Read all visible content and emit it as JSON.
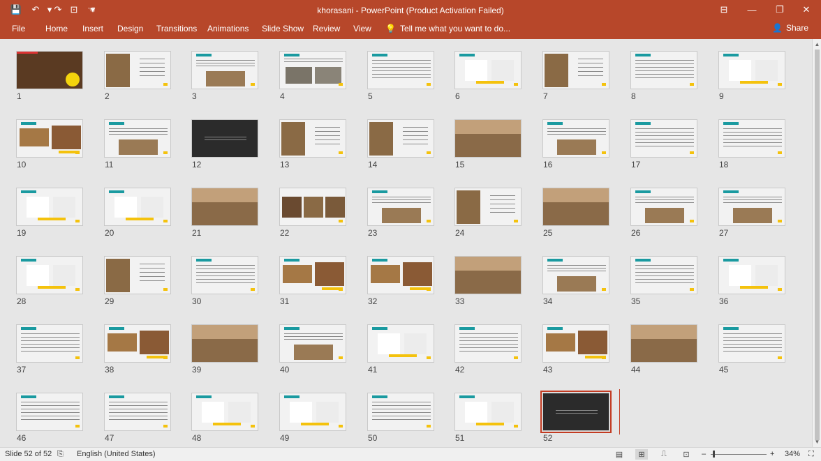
{
  "app": {
    "title": "khorasani - PowerPoint (Product Activation Failed)",
    "quick_access": [
      {
        "name": "save-icon",
        "glyph": "💾"
      },
      {
        "name": "undo-icon",
        "glyph": "↶"
      },
      {
        "name": "undo-dropdown-icon",
        "glyph": "▾"
      },
      {
        "name": "redo-icon",
        "glyph": "↷"
      },
      {
        "name": "start-from-beginning-icon",
        "glyph": "⊡"
      },
      {
        "name": "touch-mode-icon",
        "glyph": "☜"
      },
      {
        "name": "customize-qat-icon",
        "glyph": "▾"
      }
    ],
    "window_buttons": [
      {
        "name": "ribbon-display-options-icon",
        "glyph": "⊟"
      },
      {
        "name": "minimize-icon",
        "glyph": "—"
      },
      {
        "name": "restore-icon",
        "glyph": "❐"
      },
      {
        "name": "close-icon",
        "glyph": "✕"
      }
    ]
  },
  "ribbon": {
    "tabs": [
      "File",
      "Home",
      "Insert",
      "Design",
      "Transitions",
      "Animations",
      "Slide Show",
      "Review",
      "View"
    ],
    "tell_me": "Tell me what you want to do...",
    "share": "Share"
  },
  "slides": [
    {
      "n": "1",
      "style": "photo-title",
      "selected": false
    },
    {
      "n": "2",
      "style": "photo-left"
    },
    {
      "n": "3",
      "style": "text-photo"
    },
    {
      "n": "4",
      "style": "text-two-photos"
    },
    {
      "n": "5",
      "style": "text"
    },
    {
      "n": "6",
      "style": "diagram"
    },
    {
      "n": "7",
      "style": "photo-left"
    },
    {
      "n": "8",
      "style": "text"
    },
    {
      "n": "9",
      "style": "diagram"
    },
    {
      "n": "10",
      "style": "two-photos"
    },
    {
      "n": "11",
      "style": "text-photo"
    },
    {
      "n": "12",
      "style": "dark-title"
    },
    {
      "n": "13",
      "style": "photo-left"
    },
    {
      "n": "14",
      "style": "photo-left"
    },
    {
      "n": "15",
      "style": "full-photo"
    },
    {
      "n": "16",
      "style": "text-photo"
    },
    {
      "n": "17",
      "style": "text"
    },
    {
      "n": "18",
      "style": "text"
    },
    {
      "n": "19",
      "style": "diagram"
    },
    {
      "n": "20",
      "style": "diagram"
    },
    {
      "n": "21",
      "style": "full-photo"
    },
    {
      "n": "22",
      "style": "three-photos"
    },
    {
      "n": "23",
      "style": "text-photo"
    },
    {
      "n": "24",
      "style": "photo-left"
    },
    {
      "n": "25",
      "style": "full-photo"
    },
    {
      "n": "26",
      "style": "text-photo"
    },
    {
      "n": "27",
      "style": "text-photo"
    },
    {
      "n": "28",
      "style": "diagram"
    },
    {
      "n": "29",
      "style": "photo-left"
    },
    {
      "n": "30",
      "style": "text"
    },
    {
      "n": "31",
      "style": "two-photos"
    },
    {
      "n": "32",
      "style": "two-photos"
    },
    {
      "n": "33",
      "style": "full-photo"
    },
    {
      "n": "34",
      "style": "text-photo"
    },
    {
      "n": "35",
      "style": "text"
    },
    {
      "n": "36",
      "style": "diagram"
    },
    {
      "n": "37",
      "style": "text"
    },
    {
      "n": "38",
      "style": "two-photos"
    },
    {
      "n": "39",
      "style": "full-photo"
    },
    {
      "n": "40",
      "style": "text-photo"
    },
    {
      "n": "41",
      "style": "diagram"
    },
    {
      "n": "42",
      "style": "text"
    },
    {
      "n": "43",
      "style": "two-photos"
    },
    {
      "n": "44",
      "style": "full-photo"
    },
    {
      "n": "45",
      "style": "text"
    },
    {
      "n": "46",
      "style": "text"
    },
    {
      "n": "47",
      "style": "text"
    },
    {
      "n": "48",
      "style": "diagram"
    },
    {
      "n": "49",
      "style": "diagram"
    },
    {
      "n": "50",
      "style": "text"
    },
    {
      "n": "51",
      "style": "diagram"
    },
    {
      "n": "52",
      "style": "dark-title",
      "selected": true
    }
  ],
  "status": {
    "slide_info": "Slide 52 of 52",
    "language": "English (United States)",
    "zoom": "34%",
    "zoom_minus": "–",
    "zoom_plus": "+"
  },
  "colors": {
    "accent": "#b7472a",
    "teal": "#1a9aa0",
    "yellow": "#f4c20d"
  }
}
